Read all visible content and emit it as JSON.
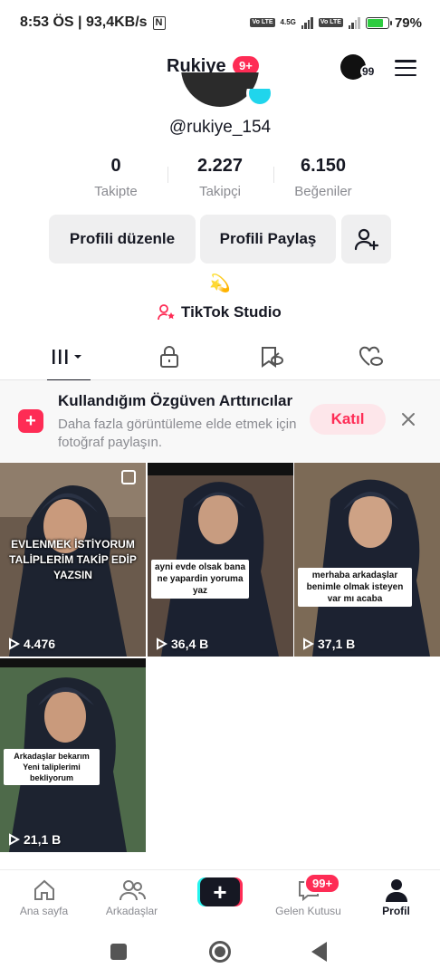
{
  "status_bar": {
    "time_speed": "8:53 ÖS | 93,4KB/s",
    "nfc": "N",
    "net_speed": "4.5G",
    "lte_label": "Vo LTE",
    "battery_pct": "79%",
    "battery_level": 0.79
  },
  "header": {
    "title": "Rukiye",
    "badge": "9+",
    "avatar_count": "99"
  },
  "profile": {
    "username": "@rukiye_154",
    "stats": [
      {
        "value": "0",
        "label": "Takipte"
      },
      {
        "value": "2.227",
        "label": "Takipçi"
      },
      {
        "value": "6.150",
        "label": "Beğeniler"
      }
    ],
    "edit_label": "Profili düzenle",
    "share_label": "Profili Paylaş",
    "bio_emoji": "💫",
    "studio_label": "TikTok Studio"
  },
  "tabs": [
    "grid-icon",
    "lock-icon",
    "bookmark-icon",
    "liked-icon"
  ],
  "banner": {
    "title": "Kullandığım Özgüven Arttırıcılar",
    "description": "Daha fazla görüntüleme elde etmek için fotoğraf paylaşın.",
    "join_label": "Katıl"
  },
  "videos": [
    {
      "caption": "EVLENMEK İSTİYORUM TALİPLERİM TAKİP EDİP YAZSIN",
      "views": "4.476"
    },
    {
      "caption": "ayni evde olsak bana ne yapardin yoruma yaz",
      "views": "36,4 B"
    },
    {
      "caption": "merhaba arkadaşlar benimle olmak isteyen var mı acaba",
      "views": "37,1 B"
    },
    {
      "caption": "Arkadaşlar bekarım Yeni taliplerimi bekliyorum",
      "views": "21,1 B"
    }
  ],
  "bottom_nav": {
    "home": "Ana sayfa",
    "friends": "Arkadaşlar",
    "inbox": "Gelen Kutusu",
    "inbox_badge": "99+",
    "profile": "Profil"
  },
  "colors": {
    "accent": "#fe2c55",
    "cyan": "#25f4ee",
    "text": "#161823",
    "muted": "#8a8b91"
  }
}
